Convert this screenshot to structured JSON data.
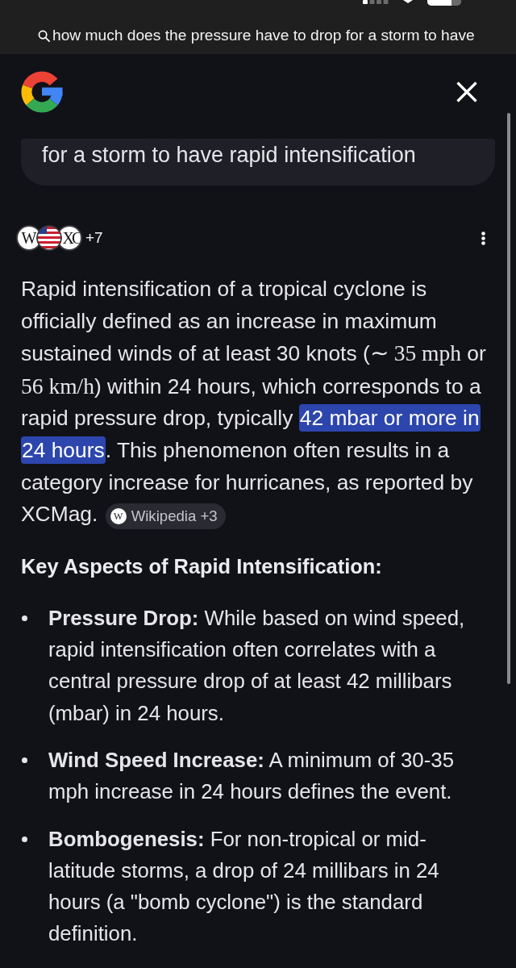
{
  "browser": {
    "url": "how much does the pressure have to drop for a storm to have"
  },
  "query": {
    "text": "for a storm to have rapid intensification"
  },
  "sources": {
    "favicons": [
      {
        "kind": "letter",
        "glyph": "W"
      },
      {
        "kind": "flag"
      },
      {
        "kind": "letter",
        "glyph": "XC"
      }
    ],
    "more": "+7"
  },
  "answer": {
    "segments": [
      {
        "kind": "text",
        "text": "Rapid intensification of a tropical cyclone is officially defined as an increase in maximum sustained winds of at least 30 knots ("
      },
      {
        "kind": "math",
        "text": "∼ 35 mph"
      },
      {
        "kind": "text",
        "text": " or "
      },
      {
        "kind": "math",
        "text": "56 km/h"
      },
      {
        "kind": "text",
        "text": ") within 24 hours, which corresponds to a rapid pressure drop, typically "
      },
      {
        "kind": "highlight",
        "text": "42 mbar or more in 24 hours"
      },
      {
        "kind": "text",
        "text": ". This phenomenon often results in a category increase for hurricanes, as reported by XCMag."
      }
    ],
    "citation": {
      "favicon": "W",
      "label": "Wikipedia +3"
    }
  },
  "key_aspects": {
    "heading": "Key Aspects of Rapid Intensification:",
    "items": [
      "**Pressure Drop:** While based on wind speed, rapid intensification often correlates with a central pressure drop of at least 42 millibars (mbar) in 24 hours.",
      "**Wind Speed Increase:** A minimum of 30-35 mph increase in 24 hours defines the event.",
      "**Bombogenesis:** For non-tropical or mid-latitude storms, a drop of 24 millibars in 24 hours (a \"bomb cyclone\") is the standard definition."
    ]
  }
}
